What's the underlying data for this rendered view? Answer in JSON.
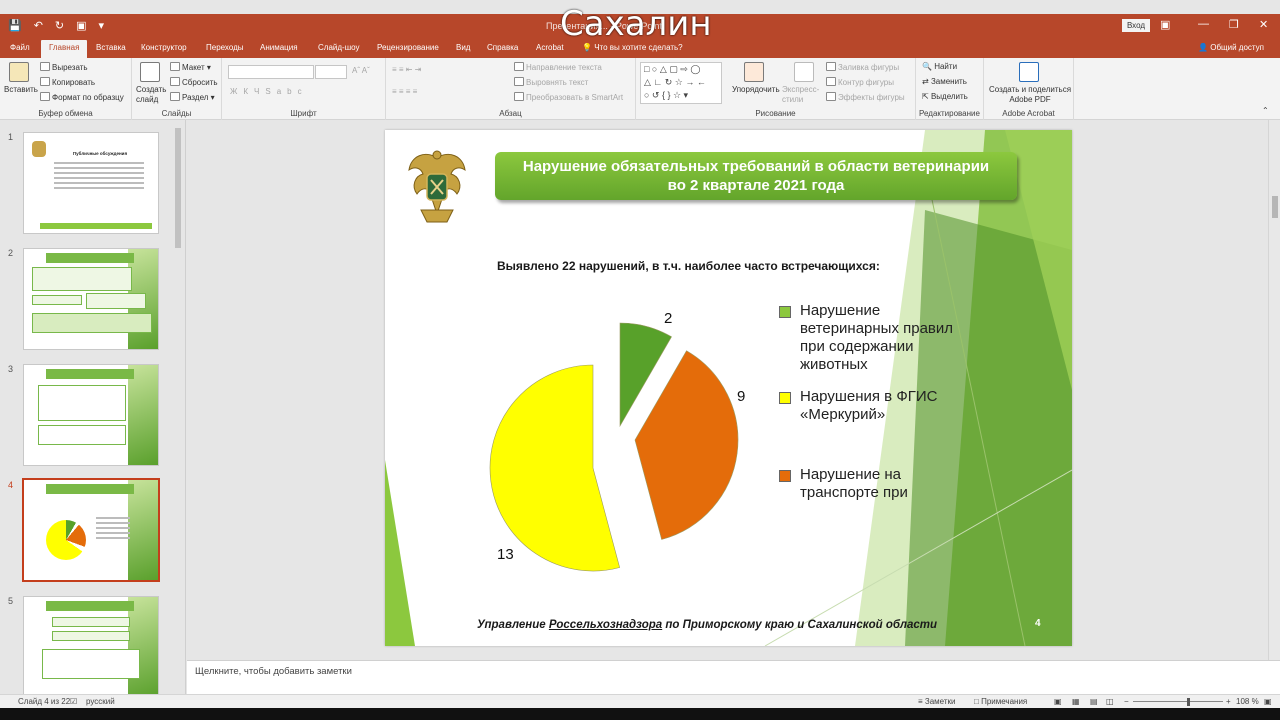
{
  "titlebar": {
    "doc_title": "Презентация... - PowerPoint",
    "overlay": "Сахалин",
    "login": "Вход"
  },
  "tabs": [
    "Файл",
    "Главная",
    "Вставка",
    "Конструктор",
    "Переходы",
    "Анимация",
    "Слайд-шоу",
    "Рецензирование",
    "Вид",
    "Справка",
    "Acrobat"
  ],
  "tell_me": "Что вы хотите сделать?",
  "share": "Общий доступ",
  "ribbon": {
    "paste": "Вставить",
    "cut": "Вырезать",
    "copy": "Копировать",
    "format_painter": "Формат по образцу",
    "clipboard": "Буфер обмена",
    "new_slide": "Создать слайд",
    "layout": "Макет",
    "reset": "Сбросить",
    "section": "Раздел",
    "slides": "Слайды",
    "font_group": "Шрифт",
    "text_dir": "Направление текста",
    "align_text": "Выровнять текст",
    "smartart": "Преобразовать в SmartArt",
    "paragraph": "Абзац",
    "arrange": "Упорядочить",
    "quick_styles": "Экспресс-стили",
    "shape_fill": "Заливка фигуры",
    "shape_outline": "Контур фигуры",
    "shape_effects": "Эффекты фигуры",
    "drawing": "Рисование",
    "find": "Найти",
    "replace": "Заменить",
    "select": "Выделить",
    "editing": "Редактирование",
    "acrobat_btn": "Создать и поделиться Adobe PDF",
    "acrobat_group": "Adobe Acrobat"
  },
  "thumbs": {
    "numbers": [
      "1",
      "2",
      "3",
      "4",
      "5"
    ],
    "slide1_title": "Публичные обсуждения",
    "slide5_title": "В составе «Меркурий»"
  },
  "slide": {
    "title_line1": "Нарушение обязательных требований в области ветеринарии",
    "title_line2": "во 2 квартале 2021 года",
    "subtitle": "Выявлено 22 нарушений, в т.ч. наиболее часто встречающихся:",
    "footer_pre": "Управление ",
    "footer_u": "Россельхознадзора",
    "footer_post": " по Приморскому краю и Сахалинской области",
    "number": "4"
  },
  "chart_data": {
    "type": "pie",
    "categories": [
      "Нарушение ветеринарных правил при содержании животных",
      "Нарушение на транспорте при",
      "Нарушения в ФГИС «Меркурий»"
    ],
    "values": [
      2,
      9,
      13
    ],
    "colors": [
      "#58a12a",
      "#e46c0a",
      "#ffff00"
    ],
    "legend": [
      {
        "label": "Нарушение ветеринарных правил при содержании животных",
        "color": "#8cc83e"
      },
      {
        "label": "Нарушения в ФГИС «Меркурий»",
        "color": "#ffff00"
      },
      {
        "label": "Нарушение на транспорте при",
        "color": "#e46c0a"
      }
    ],
    "legend_position": "right"
  },
  "notes": "Щелкните, чтобы добавить заметки",
  "status": {
    "slide_of": "Слайд 4 из 22",
    "language": "русский",
    "notes_btn": "Заметки",
    "comments_btn": "Примечания",
    "zoom": "108 %"
  }
}
